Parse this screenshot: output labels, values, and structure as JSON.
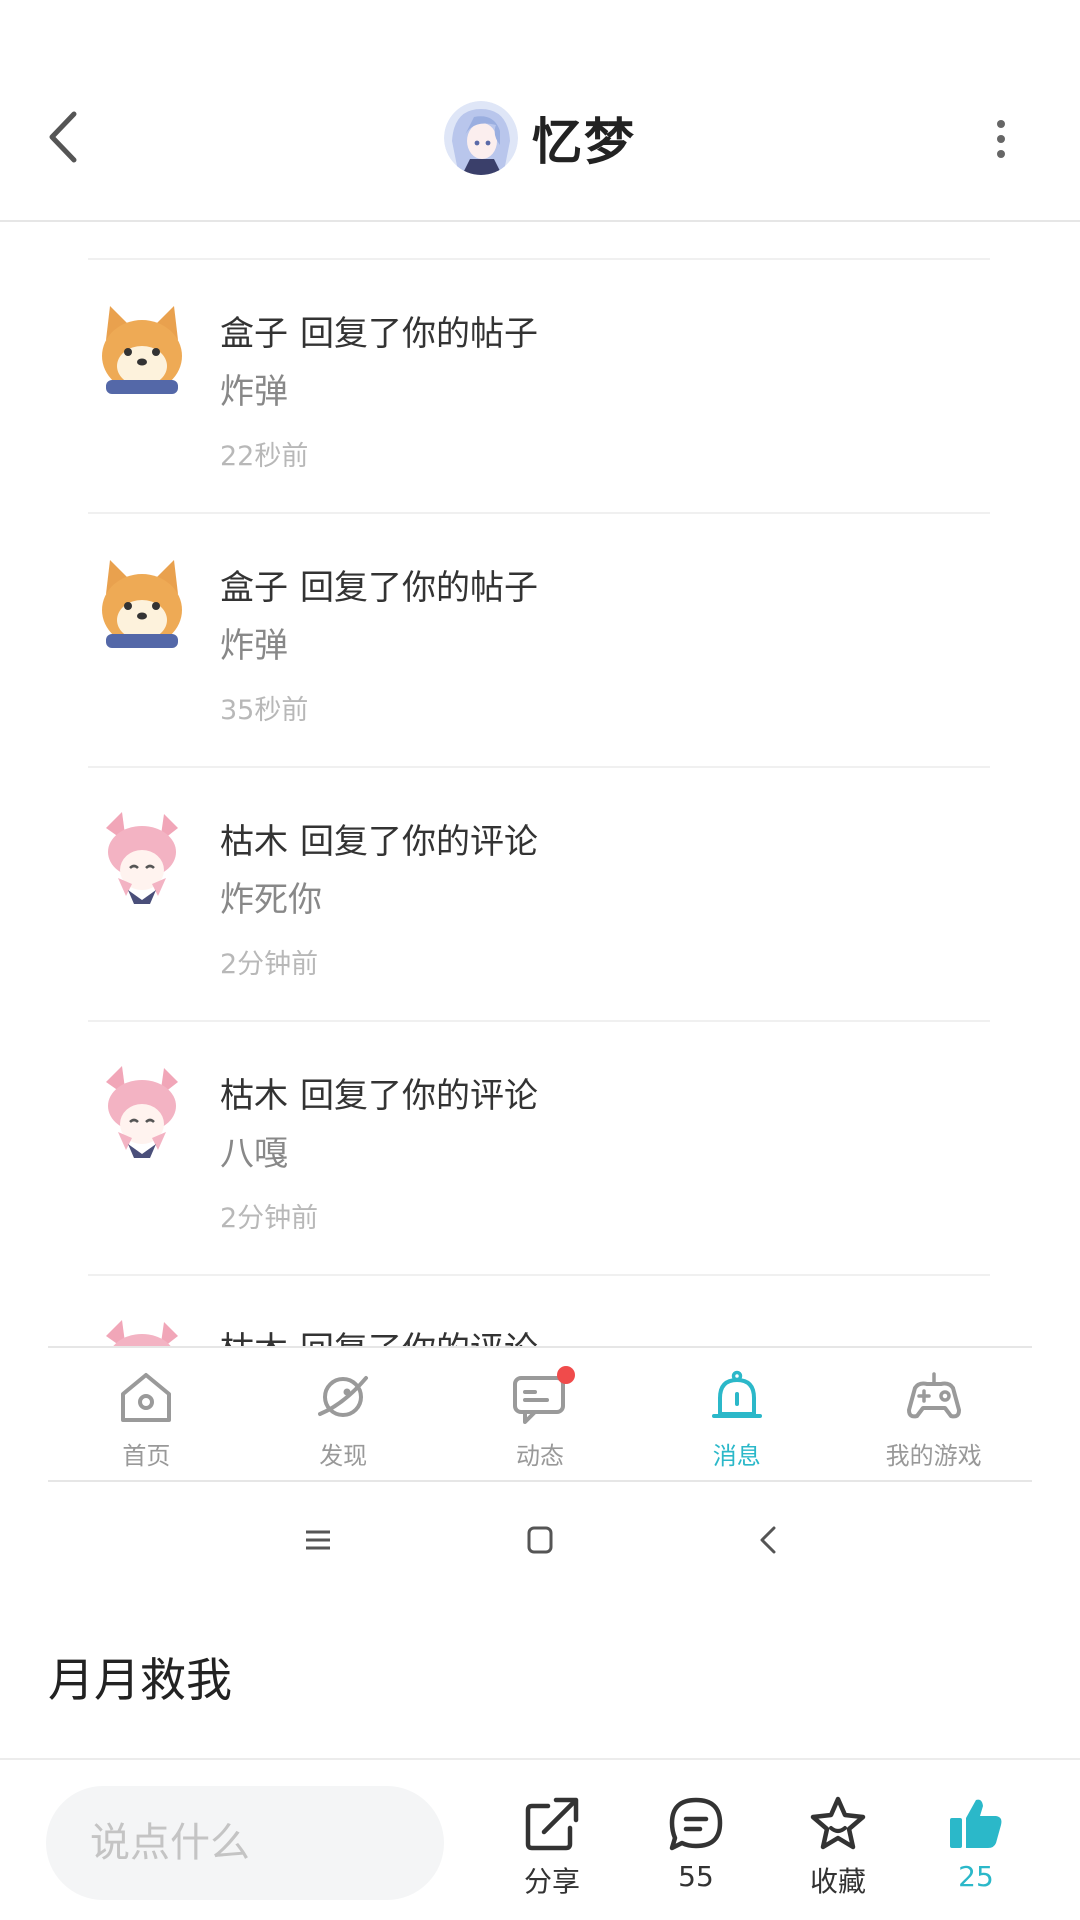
{
  "header": {
    "title": "忆梦",
    "icons": {
      "back": "chevron-left-icon",
      "more": "more-vertical-icon"
    }
  },
  "notifications": [
    {
      "user": "盒子",
      "action": "回复了你的帖子",
      "content": "炸弹",
      "time": "22秒前",
      "avatar": "shiba-avatar"
    },
    {
      "user": "盒子",
      "action": "回复了你的帖子",
      "content": "炸弹",
      "time": "35秒前",
      "avatar": "shiba-avatar"
    },
    {
      "user": "枯木",
      "action": "回复了你的评论",
      "content": "炸死你",
      "time": "2分钟前",
      "avatar": "pink-hair-avatar"
    },
    {
      "user": "枯木",
      "action": "回复了你的评论",
      "content": "八嘎",
      "time": "2分钟前",
      "avatar": "pink-hair-avatar"
    },
    {
      "user": "枯木",
      "action": "回复了你的评论",
      "content": "",
      "time": "",
      "avatar": "pink-hair-avatar"
    }
  ],
  "tabbar": [
    {
      "label": "首页",
      "icon": "home-icon"
    },
    {
      "label": "发现",
      "icon": "planet-icon"
    },
    {
      "label": "动态",
      "icon": "feed-icon"
    },
    {
      "label": "消息",
      "icon": "bell-icon",
      "active": true
    },
    {
      "label": "我的游戏",
      "icon": "gamepad-icon"
    }
  ],
  "post": {
    "text": "月月救我"
  },
  "actionbar": {
    "input_placeholder": "说点什么",
    "share_label": "分享",
    "comment_count": "55",
    "favorite_label": "收藏",
    "like_count": "25"
  },
  "colors": {
    "accent": "#2bb8c9",
    "badge": "#f04b4b"
  }
}
